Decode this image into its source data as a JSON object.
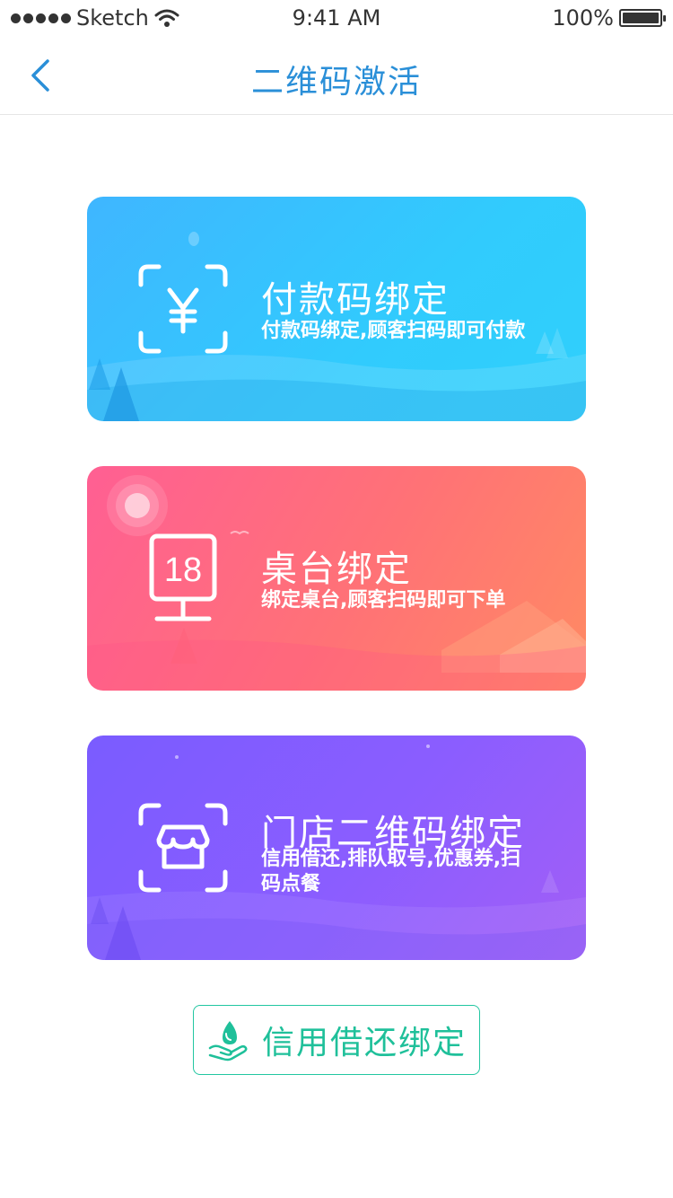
{
  "status_bar": {
    "carrier": "Sketch",
    "time": "9:41 AM",
    "battery": "100%"
  },
  "nav": {
    "title": "二维码激活"
  },
  "cards": [
    {
      "title": "付款码绑定",
      "description": "付款码绑定,顾客扫码即可付款"
    },
    {
      "title": "桌台绑定",
      "description": "绑定桌台,顾客扫码即可下单",
      "icon_number": "18"
    },
    {
      "title": "门店二维码绑定",
      "description": "信用借还,排队取号,优惠券,扫码点餐"
    }
  ],
  "credit_button": {
    "label": "信用借还绑定"
  },
  "colors": {
    "accent_blue": "#2a8fd8",
    "green": "#1fc09a",
    "card_blue": "#31cbfd",
    "card_pink": "#ff6f7f",
    "card_purple": "#8b5dff"
  }
}
